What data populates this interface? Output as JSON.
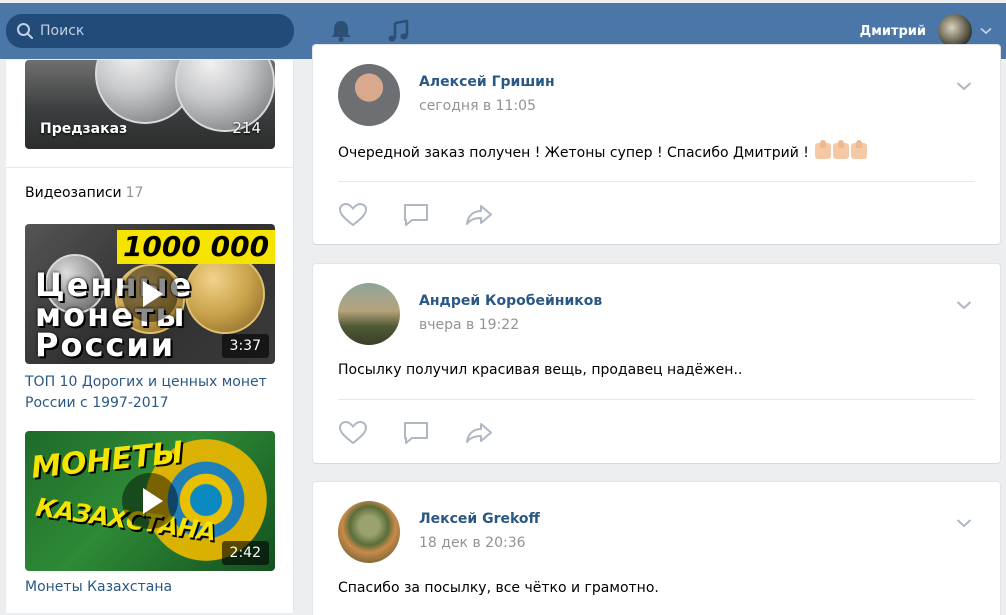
{
  "header": {
    "search_placeholder": "Поиск",
    "user_name": "Дмитрий",
    "colors": {
      "bar": "#4a76a8",
      "search": "#224b7a"
    }
  },
  "left": {
    "preorder": {
      "label": "Предзаказ",
      "count": "214"
    },
    "videos": {
      "title": "Видеозаписи",
      "count": "17"
    },
    "video_items": [
      {
        "banner": "1000 000",
        "overlay_text": "Ценные монеты России",
        "duration": "3:37",
        "title": "ТОП 10 Дорогих и ценных монет России с 1997-2017"
      },
      {
        "overlay_line1": "МОНЕТЫ",
        "overlay_line2": "КАЗАХСТАНА",
        "duration": "2:42",
        "title": "Монеты Казахстана"
      }
    ]
  },
  "posts": [
    {
      "author": "Алексей Гришин",
      "time": "сегодня в 11:05",
      "text": "Очередной заказ получен ! Жетоны супер ! Спасибо Дмитрий !"
    },
    {
      "author": "Андрей Коробейников",
      "time": "вчера в 19:22",
      "text": "Посылку получил красивая вещь, продавец надёжен.."
    },
    {
      "author": "Лексей Grekoff",
      "time": "18 дек в 20:36",
      "text": "Спасибо за посылку, все чётко и грамотно."
    }
  ],
  "icons": {
    "like": "heart-icon",
    "comment": "comment-icon",
    "share": "share-icon",
    "menu": "chevron-down-icon"
  },
  "accent": "#2a5885"
}
